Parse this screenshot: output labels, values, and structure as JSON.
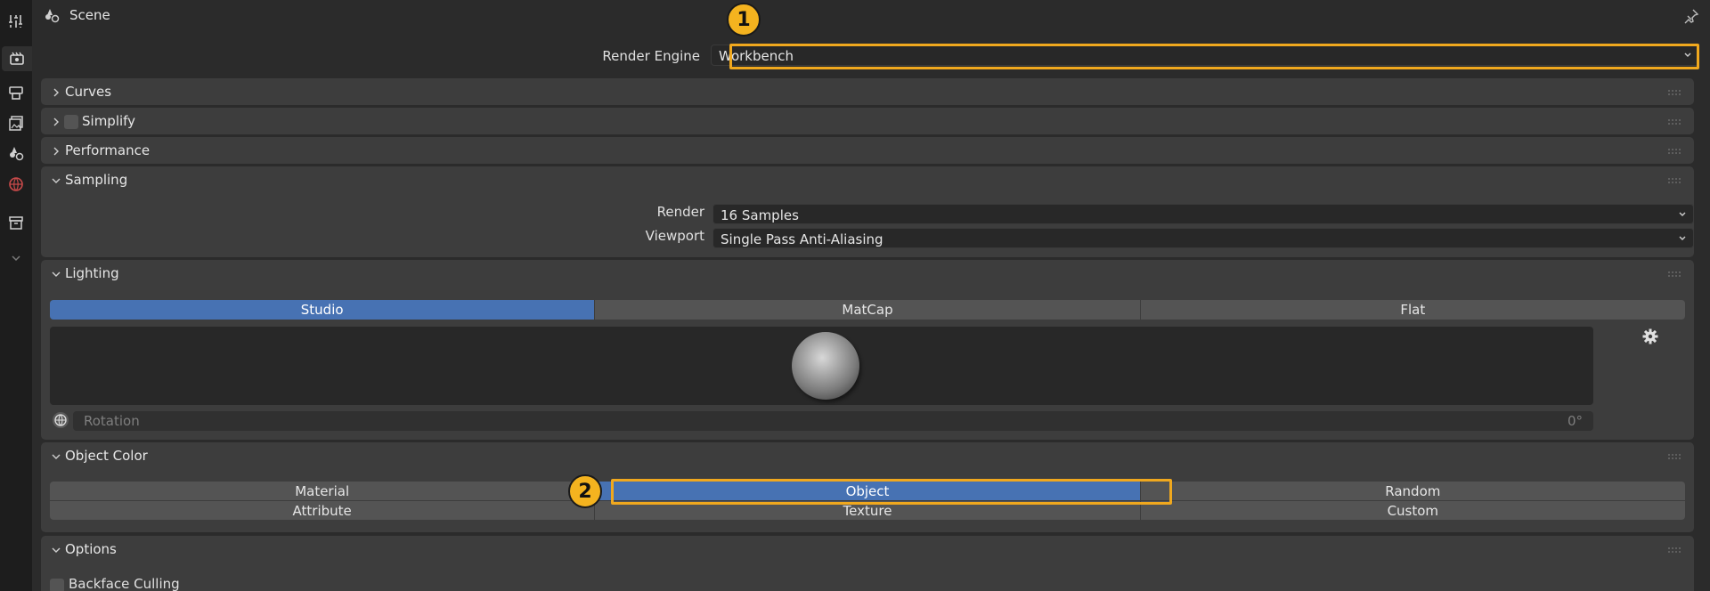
{
  "header": {
    "scene_label": "Scene"
  },
  "render_engine": {
    "label": "Render Engine",
    "value": "Workbench"
  },
  "panels": {
    "curves": {
      "title": "Curves"
    },
    "simplify": {
      "title": "Simplify"
    },
    "performance": {
      "title": "Performance"
    },
    "sampling": {
      "title": "Sampling",
      "render_label": "Render",
      "render_value": "16 Samples",
      "viewport_label": "Viewport",
      "viewport_value": "Single Pass Anti-Aliasing"
    },
    "lighting": {
      "title": "Lighting",
      "options": [
        "Studio",
        "MatCap",
        "Flat"
      ],
      "selected": "Studio",
      "rotation_label": "Rotation",
      "rotation_value": "0°"
    },
    "object_color": {
      "title": "Object Color",
      "row1": [
        "Material",
        "Object",
        "Random"
      ],
      "row2": [
        "Attribute",
        "Texture",
        "Custom"
      ],
      "selected": "Object"
    },
    "options": {
      "title": "Options",
      "backface_culling": "Backface Culling"
    }
  },
  "callouts": [
    "1",
    "2"
  ],
  "colors": {
    "accent": "#4772b3",
    "callout": "#f0a81e",
    "panel": "#3d3d3d",
    "background": "#2b2b2b"
  }
}
